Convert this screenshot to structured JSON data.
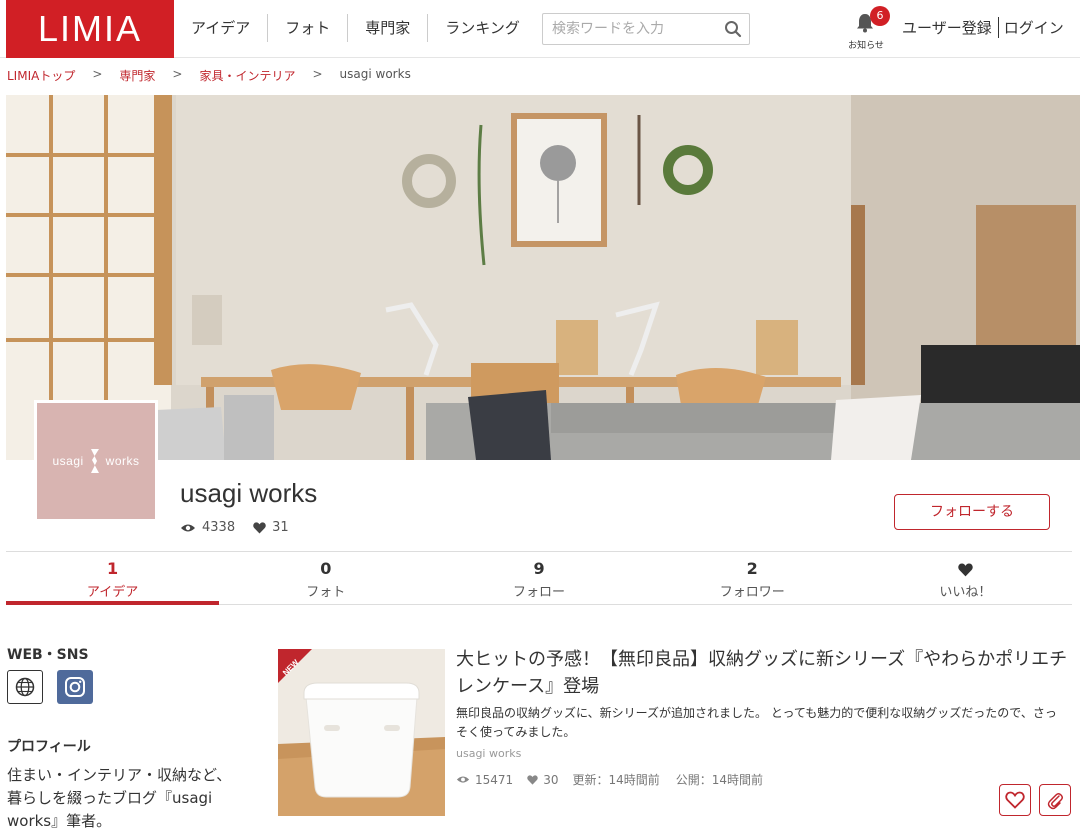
{
  "header": {
    "logo": "LIMIA",
    "nav": [
      "アイデア",
      "フォト",
      "専門家",
      "ランキング"
    ],
    "search_placeholder": "検索ワードを入力",
    "notifications": {
      "count": "6",
      "label": "お知らせ"
    },
    "register": "ユーザー登録",
    "login": "ログイン"
  },
  "breadcrumb": {
    "items": [
      "LIMIAトップ",
      "専門家",
      "家具・インテリア"
    ],
    "separator": ">",
    "current": "usagi works"
  },
  "profile": {
    "avatar_text_left": "usagi",
    "avatar_text_right": "works",
    "name": "usagi works",
    "views": "4338",
    "likes": "31",
    "follow_label": "フォローする"
  },
  "tabs": [
    {
      "count": "1",
      "label": "アイデア",
      "active": true
    },
    {
      "count": "0",
      "label": "フォト",
      "active": false
    },
    {
      "count": "9",
      "label": "フォロー",
      "active": false
    },
    {
      "count": "2",
      "label": "フォロワー",
      "active": false
    },
    {
      "count": "",
      "label": "いいね！",
      "active": false,
      "icon": "heart-icon"
    }
  ],
  "sidebar": {
    "web_sns_title": "WEB・SNS",
    "profile_title": "プロフィール",
    "profile_text": "住まい・インテリア・収納など、暮らしを綴ったブログ『usagi works』筆者。"
  },
  "article": {
    "badge": "NEW",
    "title": "大ヒットの予感！【無印良品】収納グッズに新シリーズ『やわらかポリエチレンケース』登場",
    "description": "無印良品の収納グッズに、新シリーズが追加されました。 とっても魅力的で便利な収納グッズだったので、さっそく使ってみました。",
    "author": "usagi works",
    "views": "15471",
    "likes": "30",
    "updated": "更新：14時間前",
    "published": "公開：14時間前"
  },
  "colors": {
    "brand_red": "#d11f25",
    "accent_red": "#c0262d",
    "avatar_pink": "#d8b4b1",
    "instagram_blue": "#4f6a9b"
  }
}
